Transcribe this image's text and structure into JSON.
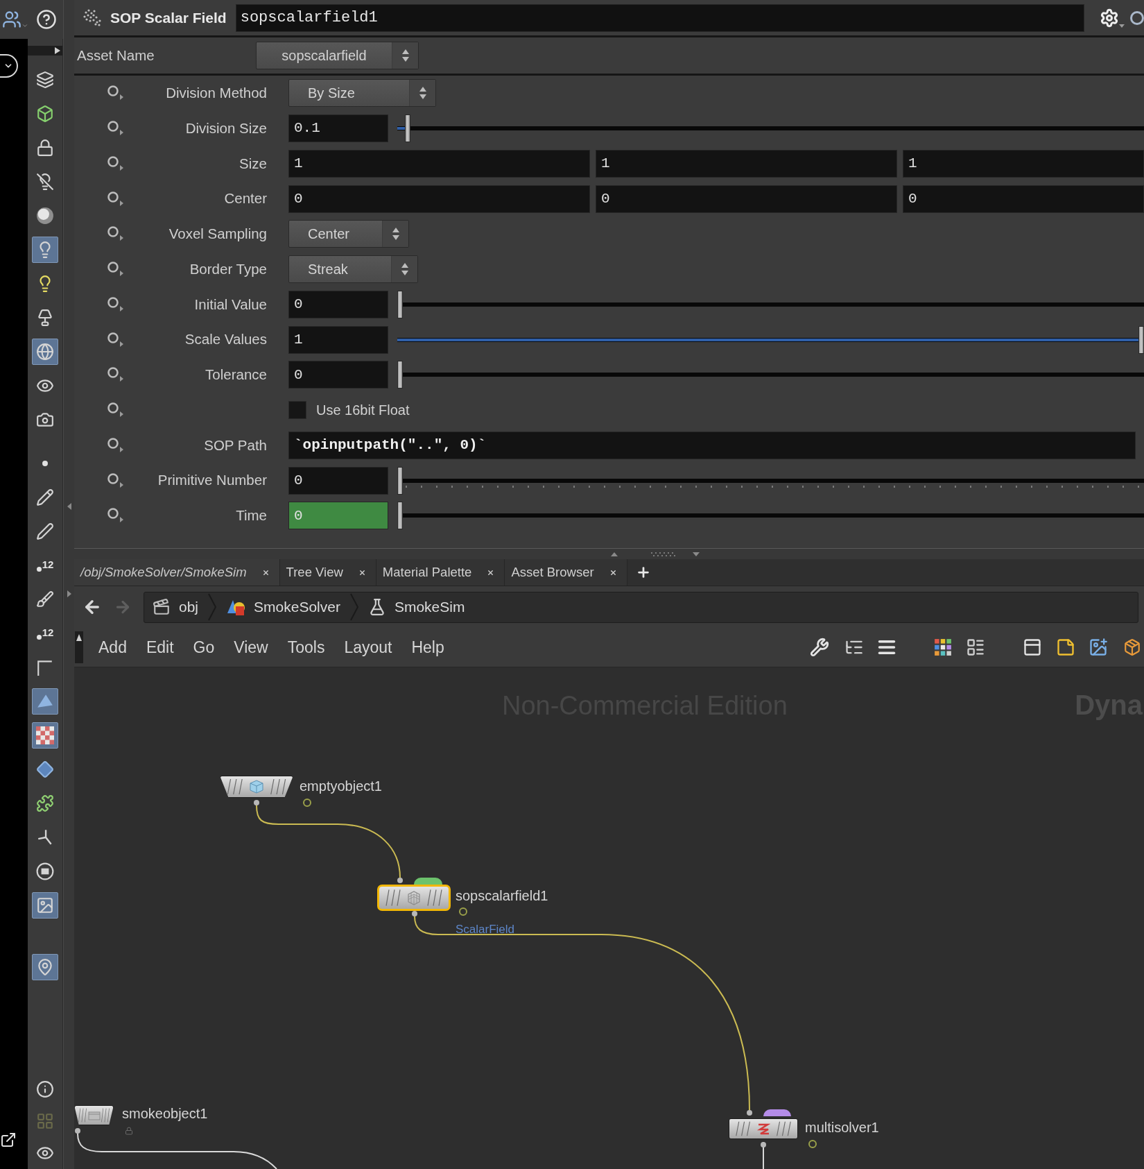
{
  "header": {
    "type_label": "SOP Scalar Field",
    "node_name": "sopscalarfield1"
  },
  "asset_name": {
    "label": "Asset Name",
    "value": "sopscalarfield"
  },
  "parameters": [
    {
      "kind": "menu",
      "label": "Division Method",
      "value": "By Size",
      "keyed": false
    },
    {
      "kind": "float",
      "label": "Division Size",
      "value": "0.1",
      "level": 0.01,
      "keyed": false
    },
    {
      "kind": "vector",
      "label": "Size",
      "values": [
        "1",
        "1",
        "1"
      ],
      "keyed": false
    },
    {
      "kind": "vector",
      "label": "Center",
      "values": [
        "0",
        "0",
        "0"
      ],
      "keyed": false
    },
    {
      "kind": "menu",
      "label": "Voxel Sampling",
      "value": "Center",
      "keyed": false
    },
    {
      "kind": "menu",
      "label": "Border Type",
      "value": "Streak",
      "keyed": false
    },
    {
      "kind": "float",
      "label": "Initial Value",
      "value": "0",
      "level": 0,
      "keyed": false
    },
    {
      "kind": "float",
      "label": "Scale Values",
      "value": "1",
      "level": 1,
      "keyed": false
    },
    {
      "kind": "float",
      "label": "Tolerance",
      "value": "0",
      "level": 0,
      "keyed": false
    },
    {
      "kind": "toggle",
      "label": "Use 16bit Float",
      "checked": false,
      "keyed": false
    },
    {
      "kind": "string",
      "label": "SOP Path",
      "value": "`opinputpath(\"..\", 0)`",
      "keyed": false
    },
    {
      "kind": "int",
      "label": "Primitive Number",
      "value": "0",
      "level": 0,
      "keyed": false
    },
    {
      "kind": "float",
      "label": "Time",
      "value": "0",
      "level": 0,
      "keyed": true
    }
  ],
  "pane_tabs": [
    {
      "label": "/obj/SmokeSolver/SmokeSim",
      "selected": true
    },
    {
      "label": "Tree View",
      "selected": false
    },
    {
      "label": "Material Palette",
      "selected": false
    },
    {
      "label": "Asset Browser",
      "selected": false
    }
  ],
  "path_bar": [
    {
      "label": "obj",
      "kind": "objects"
    },
    {
      "label": "SmokeSolver",
      "kind": "solver"
    },
    {
      "label": "SmokeSim",
      "kind": "dop"
    }
  ],
  "menu": [
    "Add",
    "Edit",
    "Go",
    "View",
    "Tools",
    "Layout",
    "Help"
  ],
  "network": {
    "watermark": "Non-Commercial Edition",
    "context_label": "Dyna",
    "nodes": [
      {
        "name": "emptyobject1",
        "kind": "empty_object",
        "selected": false
      },
      {
        "name": "sopscalarfield1",
        "kind": "scalar_field",
        "selected": true,
        "color": "#6cc26c",
        "output_label": "ScalarField"
      },
      {
        "name": "multisolver1",
        "kind": "multisolver",
        "selected": false,
        "color": "#b48ce8"
      },
      {
        "name": "smokeobject1",
        "kind": "smoke_object",
        "selected": false
      }
    ]
  },
  "toolbar": {
    "groups": [
      [
        {
          "kind": "layers",
          "selected": false
        },
        {
          "kind": "cube",
          "selected": false
        },
        {
          "kind": "lock",
          "selected": false
        },
        {
          "kind": "bulb_off",
          "selected": false
        },
        {
          "kind": "sphere",
          "selected": false
        },
        {
          "kind": "bulb",
          "selected": true
        },
        {
          "kind": "bulb_plus",
          "selected": false
        },
        {
          "kind": "lamp",
          "selected": false
        },
        {
          "kind": "globe",
          "selected": true
        },
        {
          "kind": "eye",
          "selected": false
        },
        {
          "kind": "camera",
          "selected": false
        }
      ],
      [
        {
          "kind": "dot",
          "selected": false
        },
        {
          "kind": "pencil",
          "selected": false
        },
        {
          "kind": "pen",
          "selected": false
        },
        {
          "kind": "numbers",
          "label": "12",
          "selected": false
        },
        {
          "kind": "brush",
          "selected": false
        },
        {
          "kind": "numbers",
          "label": "12",
          "selected": false
        },
        {
          "kind": "angle",
          "selected": false
        },
        {
          "kind": "triangle",
          "selected": true
        },
        {
          "kind": "checker",
          "selected": true
        },
        {
          "kind": "diamond",
          "selected": false
        },
        {
          "kind": "puzzle",
          "selected": false
        },
        {
          "kind": "tripod",
          "selected": false
        },
        {
          "kind": "stop",
          "selected": false
        },
        {
          "kind": "image",
          "selected": true
        }
      ],
      [
        {
          "kind": "pin",
          "selected": true
        }
      ],
      [
        {
          "kind": "info",
          "selected": false
        },
        {
          "kind": "grid",
          "selected": false
        },
        {
          "kind": "eye",
          "selected": false
        }
      ]
    ]
  }
}
